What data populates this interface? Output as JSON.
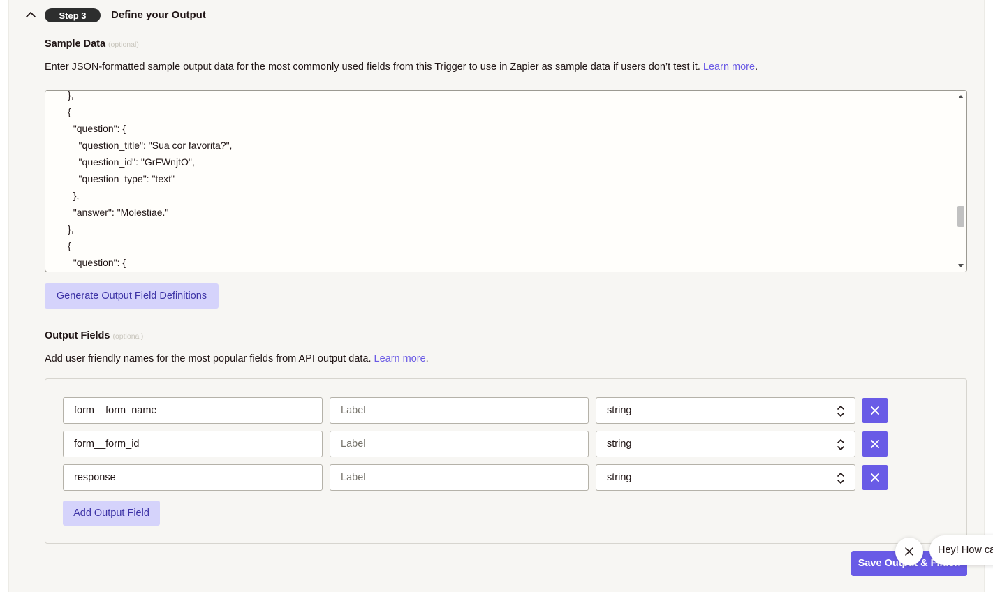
{
  "step": {
    "badge": "Step 3",
    "title": "Define your Output"
  },
  "sample_data": {
    "label": "Sample Data",
    "optional": "(optional)",
    "description": "Enter JSON-formatted sample output data for the most commonly used fields from this Trigger to use in Zapier as sample data if users don’t test it.",
    "learn_more": "Learn more",
    "code_lines": [
      "},",
      "{",
      "  \"question\": {",
      "    \"question_title\": \"Sua cor favorita?\",",
      "    \"question_id\": \"GrFWnjtO\",",
      "    \"question_type\": \"text\"",
      "  },",
      "  \"answer\": \"Molestiae.\"",
      "},",
      "{",
      "  \"question\": {"
    ],
    "generate_button": "Generate Output Field Definitions"
  },
  "output_fields": {
    "label": "Output Fields",
    "optional": "(optional)",
    "description": "Add user friendly names for the most popular fields from API output data.",
    "learn_more": "Learn more",
    "rows": [
      {
        "key": "form__form_name",
        "label_placeholder": "Label",
        "type": "string"
      },
      {
        "key": "form__form_id",
        "label_placeholder": "Label",
        "type": "string"
      },
      {
        "key": "response",
        "label_placeholder": "Label",
        "type": "string"
      }
    ],
    "add_button": "Add Output Field"
  },
  "save_button": "Save Output & Finish",
  "chat": {
    "message": "Hey! How ca"
  },
  "colors": {
    "accent": "#695be6",
    "accent_light": "#d5d3fb",
    "link": "#6b5be5",
    "badge_bg": "#2d2e2e",
    "panel_bg": "#f7f6f3"
  }
}
